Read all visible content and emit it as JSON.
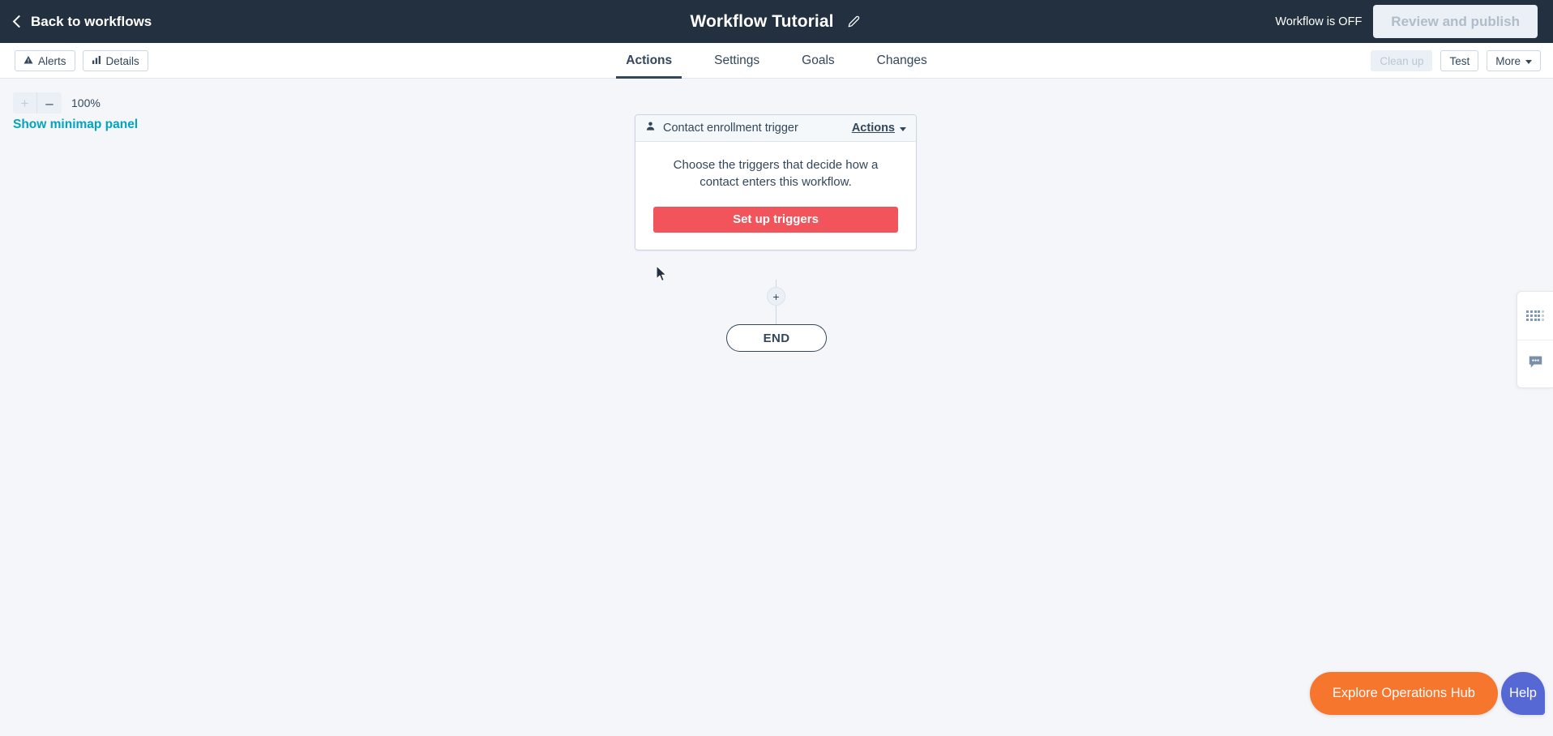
{
  "topbar": {
    "back_label": "Back to workflows",
    "back_icon": "chevron-left-icon",
    "title": "Workflow Tutorial",
    "edit_icon": "pencil-icon",
    "status_text": "Workflow is OFF",
    "publish_label": "Review and publish"
  },
  "subbar": {
    "left_buttons": [
      {
        "label": "Alerts",
        "icon": "warning-triangle-icon",
        "disabled": false
      },
      {
        "label": "Details",
        "icon": "bar-chart-icon",
        "disabled": false
      }
    ],
    "tabs": [
      {
        "label": "Actions",
        "active": true
      },
      {
        "label": "Settings",
        "active": false
      },
      {
        "label": "Goals",
        "active": false
      },
      {
        "label": "Changes",
        "active": false
      }
    ],
    "right_buttons": [
      {
        "label": "Clean up",
        "disabled": true
      },
      {
        "label": "Test",
        "disabled": false
      },
      {
        "label": "More",
        "disabled": false,
        "caret": true
      }
    ]
  },
  "canvas": {
    "zoom": {
      "plus_label": "+",
      "minus_label": "–",
      "level": "100%"
    },
    "minimap_link": "Show minimap panel",
    "trigger_card": {
      "icon": "contact-person-icon",
      "header_title": "Contact enrollment trigger",
      "actions_label": "Actions",
      "description": "Choose the triggers that decide how a contact enters this workflow.",
      "cta_label": "Set up triggers",
      "cta_color": "#f2545b"
    },
    "add_step_label": "+",
    "end_node_label": "END"
  },
  "side_dock": {
    "items": [
      {
        "icon": "apps-grid-icon"
      },
      {
        "icon": "chat-bubble-icon"
      }
    ]
  },
  "footer": {
    "ops_hub_label": "Explore Operations Hub",
    "ops_hub_color": "#f5762c",
    "help_label": "Help",
    "help_color": "#5568d3"
  }
}
